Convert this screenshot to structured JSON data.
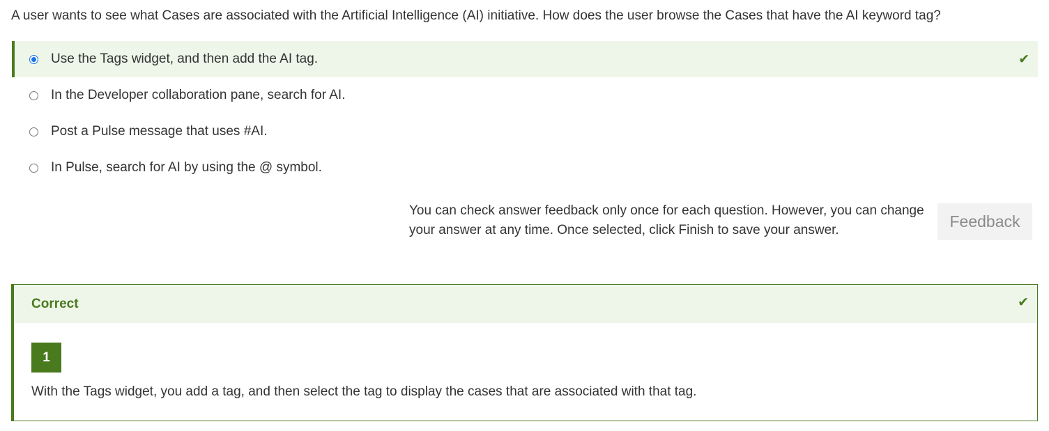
{
  "question": {
    "text": "A user wants to see what Cases are associated with the Artificial Intelligence (AI) initiative. How does the user browse the Cases that have the AI keyword tag?"
  },
  "options": [
    {
      "label": "Use the Tags widget, and then add the AI tag.",
      "selected": true,
      "correct": true
    },
    {
      "label": "In the Developer collaboration pane, search for AI.",
      "selected": false
    },
    {
      "label": "Post a Pulse message that uses #AI.",
      "selected": false
    },
    {
      "label": "In Pulse, search for AI by using the @ symbol.",
      "selected": false
    }
  ],
  "note": {
    "text": "You can check answer feedback only once for each question. However, you can change your answer at any time. Once selected, click Finish to save your answer."
  },
  "feedback_button": {
    "label": "Feedback"
  },
  "result": {
    "title": "Correct",
    "badge": "1",
    "explanation": "With the Tags widget, you add a tag, and then select the tag to display the cases that are associated with that tag."
  },
  "icons": {
    "check": "check-icon",
    "radio": "radio-icon"
  },
  "colors": {
    "success": "#4a7a1e",
    "success_bg": "#eef6ea",
    "radio_selected": "#1a73e8"
  }
}
